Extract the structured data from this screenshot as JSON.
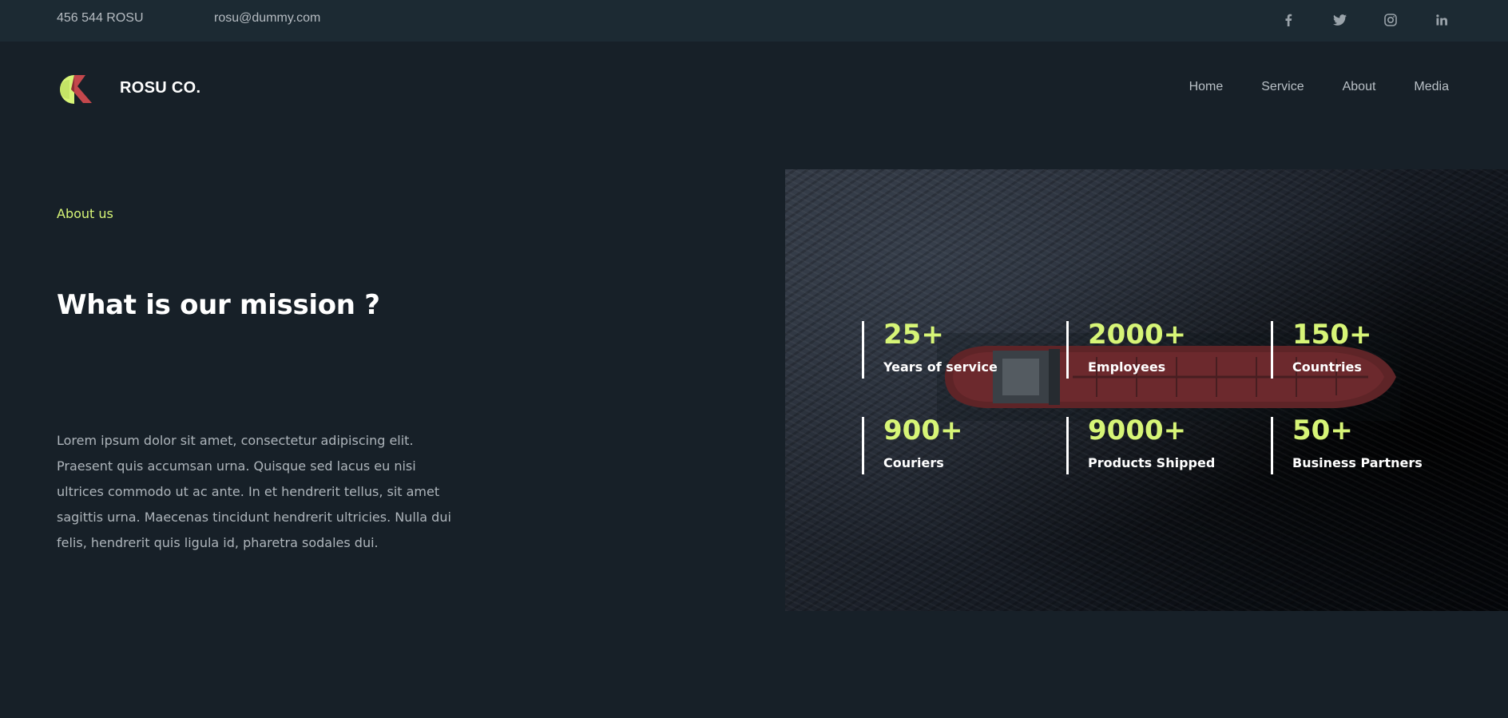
{
  "topbar": {
    "phone": "456 544 ROSU",
    "email": "rosu@dummy.com",
    "social": [
      "facebook-icon",
      "twitter-icon",
      "instagram-icon",
      "linkedin-icon"
    ]
  },
  "header": {
    "brand": "ROSU CO.",
    "nav": [
      "Home",
      "Service",
      "About",
      "Media"
    ]
  },
  "about": {
    "eyebrow": "About us",
    "title": "What is our mission ?",
    "body": "Lorem ipsum dolor sit amet, consectetur adipiscing elit. Praesent quis accumsan urna. Quisque sed lacus eu nisi ultrices commodo ut ac ante. In et hendrerit tellus, sit amet sagittis urna. Maecenas tincidunt hendrerit ultricies. Nulla dui felis, hendrerit quis ligula id, pharetra sodales dui."
  },
  "stats": [
    {
      "value": "25+",
      "label": "Years of service"
    },
    {
      "value": "2000+",
      "label": "Employees"
    },
    {
      "value": "150+",
      "label": "Countries"
    },
    {
      "value": "900+",
      "label": "Couriers"
    },
    {
      "value": "9000+",
      "label": "Products Shipped"
    },
    {
      "value": "50+",
      "label": "Business Partners"
    }
  ],
  "colors": {
    "background": "#172028",
    "topbar": "#1c2a33",
    "accent": "#d7f577",
    "logo_red": "#c4474c"
  }
}
